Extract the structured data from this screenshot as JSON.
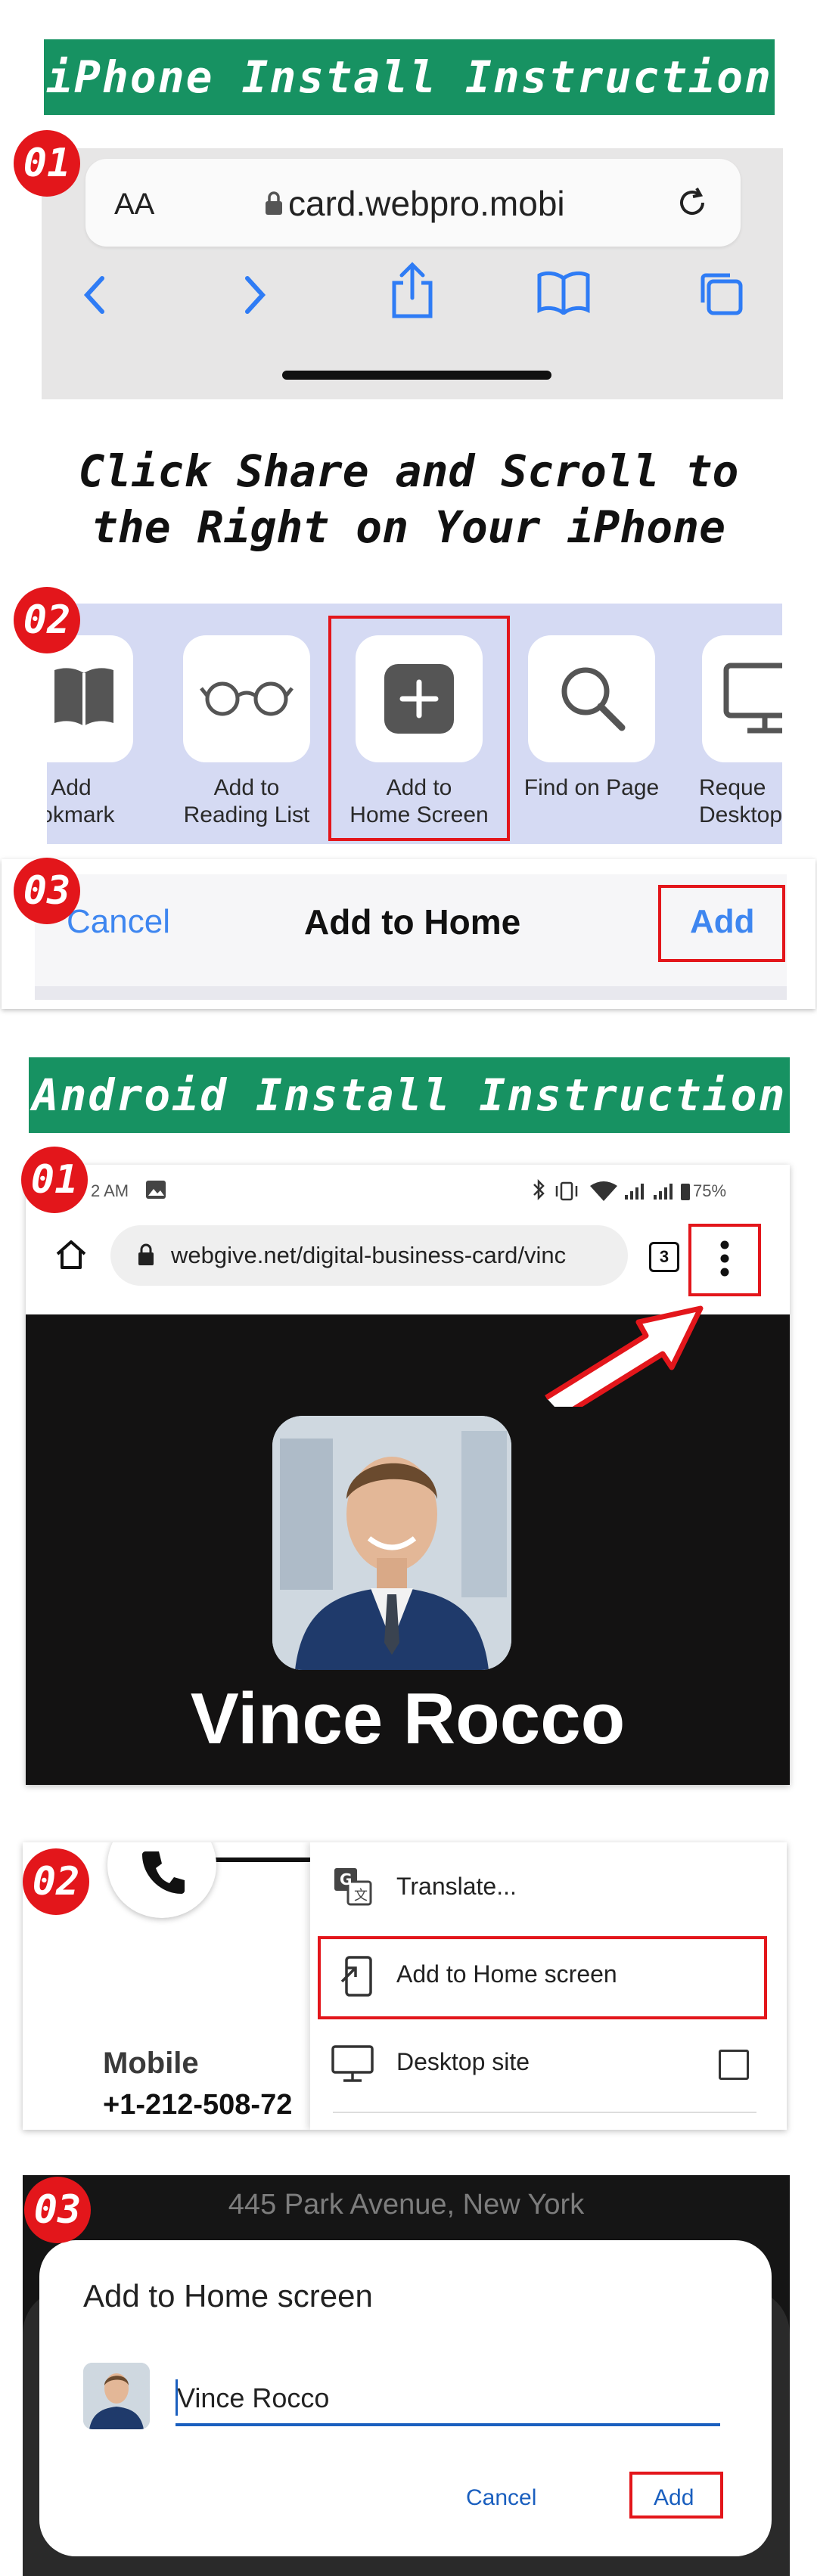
{
  "ios": {
    "banner": "iPhone Install Instruction",
    "step1": {
      "badge": "01",
      "text_size": "AA",
      "url": "card.webpro.mobi"
    },
    "caption_line1": "Click Share and Scroll to",
    "caption_line2": "the Right on Your iPhone",
    "step2": {
      "badge": "02",
      "items": [
        {
          "label": "Add\nookmark",
          "icon": "book-icon"
        },
        {
          "label": "Add to\nReading List",
          "icon": "glasses-icon"
        },
        {
          "label": "Add to\nHome Screen",
          "icon": "plus-square-icon"
        },
        {
          "label": "Find on Page",
          "icon": "magnifier-icon"
        },
        {
          "label": "Reque\nDesktop",
          "icon": "monitor-icon"
        }
      ]
    },
    "step3": {
      "badge": "03",
      "cancel": "Cancel",
      "title": "Add to Home",
      "add": "Add"
    }
  },
  "android": {
    "banner": "Android Install Instruction",
    "step1": {
      "badge": "01",
      "time": "2 AM",
      "battery": "75%",
      "url": "webgive.net/digital-business-card/vinc",
      "tabs_count": "3",
      "profile_name": "Vince Rocco"
    },
    "step2": {
      "badge": "02",
      "menu": [
        "Translate...",
        "Add to Home screen",
        "Desktop site"
      ],
      "contact_label": "Mobile",
      "contact_value": "+1-212-508-72"
    },
    "step3": {
      "badge": "03",
      "address": "445 Park Avenue, New York",
      "dialog_title": "Add to Home screen",
      "name_value": "Vince Rocco",
      "cancel": "Cancel",
      "add": "Add"
    }
  },
  "colors": {
    "banner_green": "#179262",
    "badge_red": "#e3161b",
    "ios_blue": "#2f7cf5",
    "android_blue": "#1a5fbf"
  }
}
